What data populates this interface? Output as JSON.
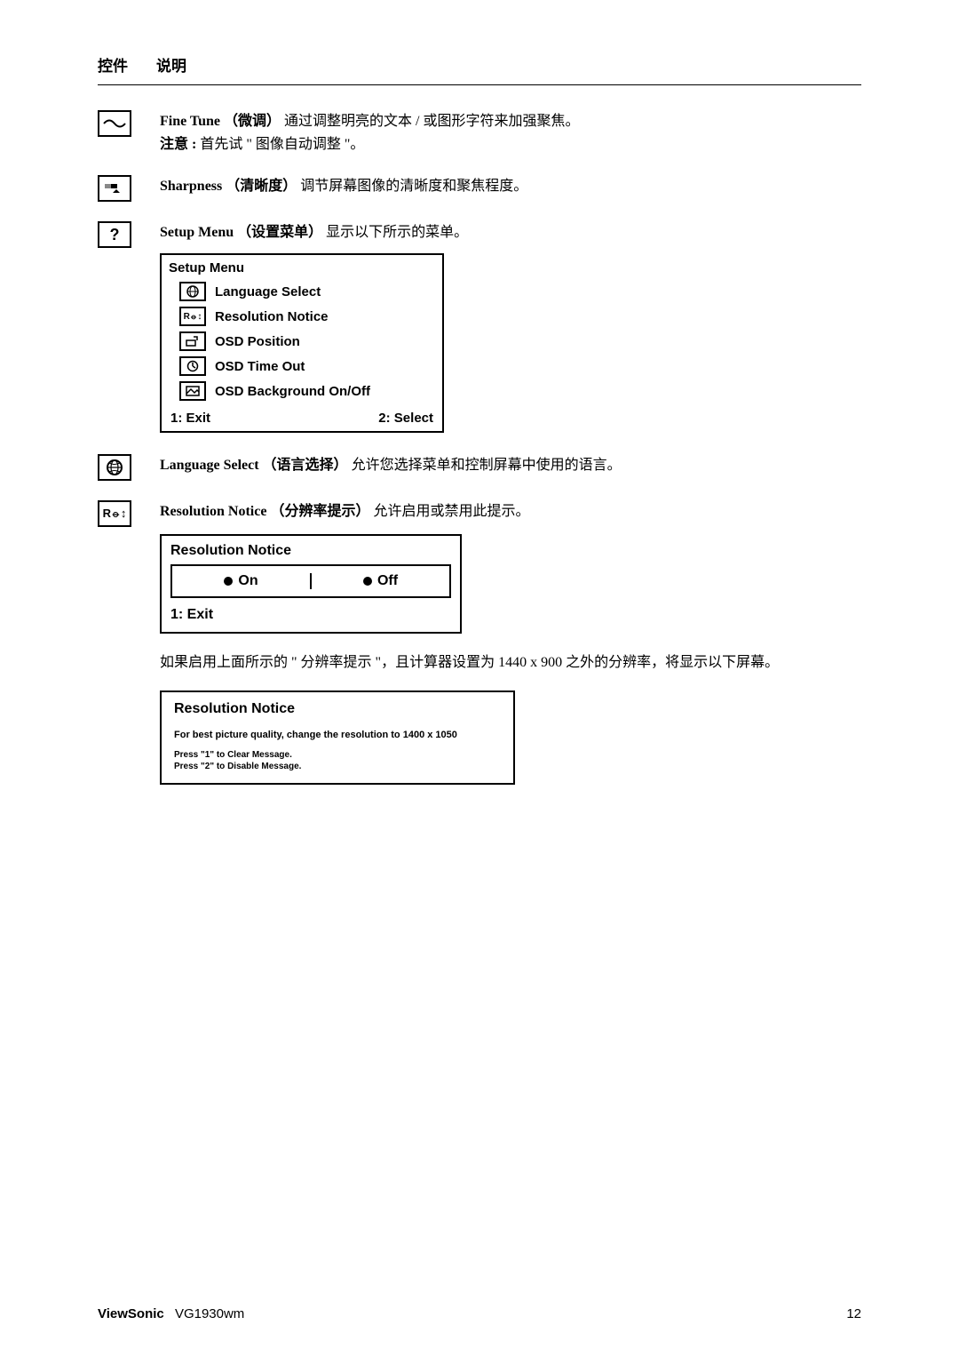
{
  "header": {
    "control": "控件",
    "description": "说明"
  },
  "fine_tune": {
    "title": "Fine Tune",
    "title_cn": "（微调）",
    "desc": "通过调整明亮的文本 / 或图形字符来加强聚焦。",
    "note_label": "注意 :",
    "note_text": " 首先试 \" 图像自动调整 \"。"
  },
  "sharpness": {
    "title": "Sharpness",
    "title_cn": "（清晰度）",
    "desc": "调节屏幕图像的清晰度和聚焦程度。"
  },
  "setup_menu": {
    "title": "Setup Menu",
    "title_cn": "（设置菜单）",
    "desc": "显示以下所示的菜单。",
    "box_title": "Setup Menu",
    "items": [
      "Language Select",
      "Resolution Notice",
      "OSD Position",
      "OSD Time Out",
      "OSD Background On/Off"
    ],
    "exit": "1: Exit",
    "select": "2: Select"
  },
  "language_select": {
    "title": "Language Select",
    "title_cn": "（语言选择）",
    "desc": "允许您选择菜单和控制屏幕中使用的语言。"
  },
  "resolution_notice": {
    "title": "Resolution Notice",
    "title_cn": "（分辨率提示）",
    "desc": "允许启用或禁用此提示。",
    "box_title": "Resolution Notice",
    "on": "On",
    "off": "Off",
    "exit": "1: Exit",
    "para": "如果启用上面所示的 \" 分辨率提示 \"，且计算器设置为 1440 x 900 之外的分辨率，将显示以下屏幕。",
    "notice2_title": "Resolution Notice",
    "notice2_line": "For best picture quality, change the resolution to 1400 x 1050",
    "notice2_l1": "Press \"1\" to Clear Message.",
    "notice2_l2": "Press \"2\" to Disable Message."
  },
  "footer": {
    "brand": "ViewSonic",
    "model": "VG1930wm",
    "page": "12"
  }
}
